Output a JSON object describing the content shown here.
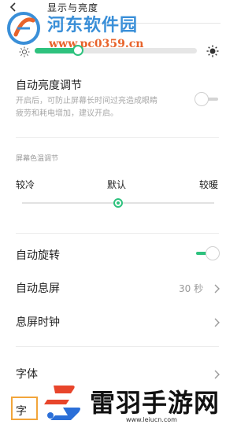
{
  "header": {
    "title": "显示与亮度"
  },
  "watermark": {
    "site_name": "河东软件园",
    "url": "www.pc0359.cn"
  },
  "brightness": {
    "level_percent": 22
  },
  "auto_brightness": {
    "title": "自动亮度调节",
    "description_line1": "开启后，可防止屏幕长时间过亮造成眼睛",
    "description_line2": "疲劳和耗电增加，建议开启。",
    "enabled": false
  },
  "color_temperature": {
    "section_label": "屏幕色温调节",
    "cool_label": "较冷",
    "default_label": "默认",
    "warm_label": "较暖",
    "level_percent": 50
  },
  "auto_rotate": {
    "title": "自动旋转",
    "enabled": true
  },
  "screen_timeout": {
    "title": "自动息屏",
    "value": "30 秒"
  },
  "screen_off_clock": {
    "title": "息屏时钟"
  },
  "font": {
    "title": "字体"
  },
  "font_size_partial": {
    "title": "字体"
  },
  "promo": {
    "title": "雷羽手游网",
    "url": "www.leiucn.com"
  },
  "colors": {
    "accent": "#2ec27e",
    "watermark_blue": "#3a8fd8",
    "watermark_orange": "#e8632b",
    "promo_red": "#e8452b",
    "promo_blue": "#2b6fd8"
  }
}
